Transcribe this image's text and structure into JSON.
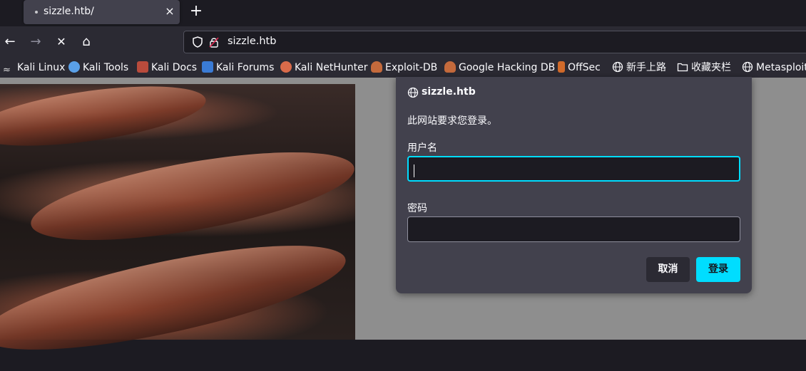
{
  "browser": {
    "tab_title": "sizzle.htb/",
    "tab_close": "×",
    "new_tab": "+",
    "url": "sizzle.htb",
    "nav": {
      "back": "←",
      "forward": "→",
      "stop": "✕",
      "home": "⌂"
    }
  },
  "bookmarks": [
    {
      "label": "Kali Linux",
      "icon": "kali-dragon-icon",
      "color": "#e0e0e0"
    },
    {
      "label": "Kali Tools",
      "icon": "kali-tools-icon",
      "color": "#5aa0e8"
    },
    {
      "label": "Kali Docs",
      "icon": "kali-docs-icon",
      "color": "#b94b3c"
    },
    {
      "label": "Kali Forums",
      "icon": "kali-forums-icon",
      "color": "#3a7bd5"
    },
    {
      "label": "Kali NetHunter",
      "icon": "nethunter-icon",
      "color": "#d96b4a"
    },
    {
      "label": "Exploit-DB",
      "icon": "exploit-db-icon",
      "color": "#c46a3c"
    },
    {
      "label": "Google Hacking DB",
      "icon": "ghdb-icon",
      "color": "#c46a3c"
    },
    {
      "label": "OffSec",
      "icon": "offsec-icon",
      "color": "#d06a2a"
    },
    {
      "label": "新手上路",
      "icon": "globe-icon",
      "color": "#fbfbfe"
    },
    {
      "label": "收藏夹栏",
      "icon": "folder-icon",
      "color": "#fbfbfe"
    },
    {
      "label": "Metasploit",
      "icon": "globe-icon",
      "color": "#fbfbfe"
    }
  ],
  "dialog": {
    "host": "sizzle.htb",
    "message": "此网站要求您登录。",
    "username_label": "用户名",
    "username_value": "",
    "password_label": "密码",
    "password_value": "",
    "cancel_label": "取消",
    "login_label": "登录"
  },
  "colors": {
    "accent": "#00ddff",
    "dialog_bg": "#42414d",
    "page_overlay": "#8e8e8e"
  }
}
